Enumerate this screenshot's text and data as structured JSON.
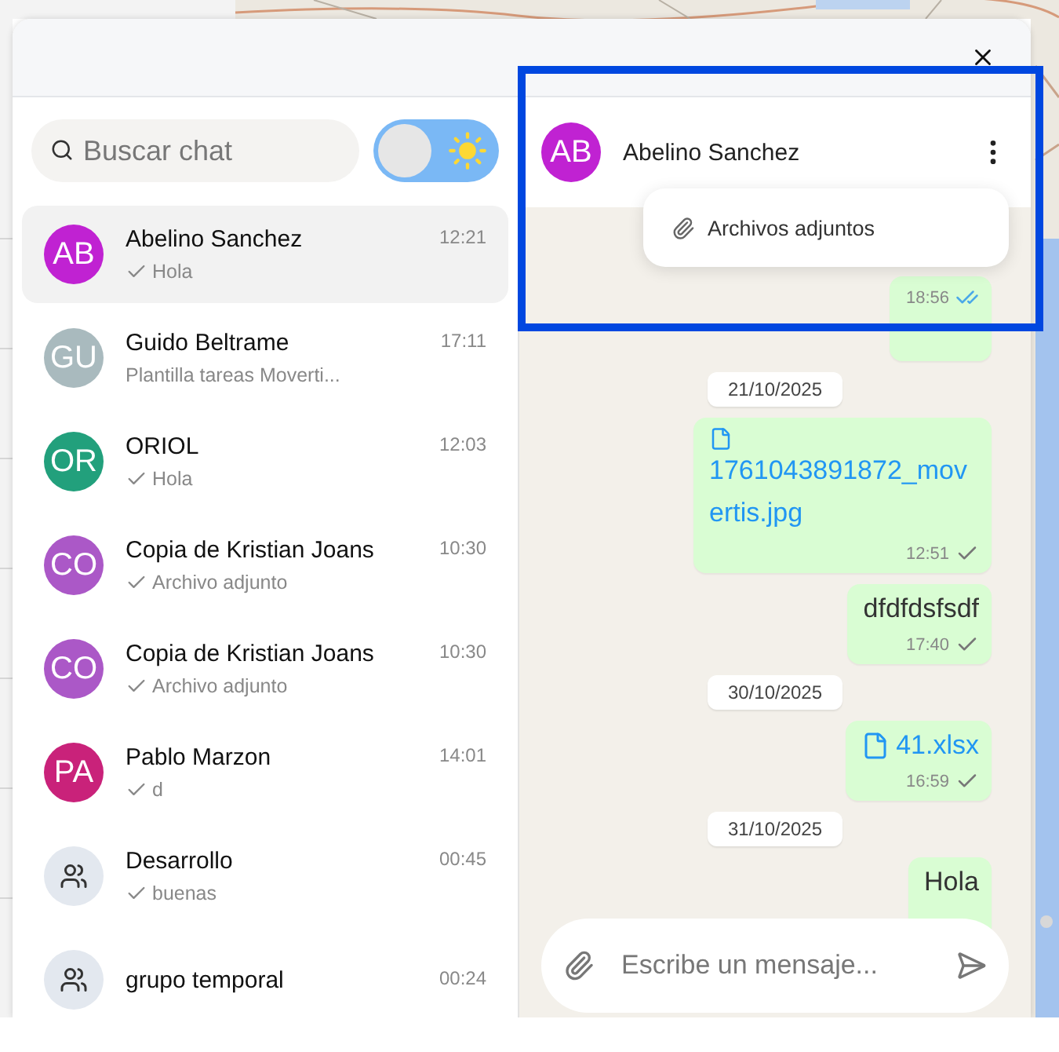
{
  "search": {
    "placeholder": "Buscar chat"
  },
  "theme_toggle": {
    "dark": false
  },
  "chats": [
    {
      "kind": "contact",
      "initials": "AB",
      "color": "#c022d2",
      "name": "Abelino Sanchez",
      "time": "12:21",
      "preview": "Hola",
      "ticked": true,
      "selected": true
    },
    {
      "kind": "contact",
      "initials": "GU",
      "color": "#a9babe",
      "name": "Guido Beltrame",
      "time": "17:11",
      "preview": "Plantilla tareas Moverti...",
      "ticked": false,
      "selected": false
    },
    {
      "kind": "contact",
      "initials": "OR",
      "color": "#22a07c",
      "name": "ORIOL",
      "time": "12:03",
      "preview": "Hola",
      "ticked": true,
      "selected": false
    },
    {
      "kind": "contact",
      "initials": "CO",
      "color": "#ab58c7",
      "name": "Copia de Kristian Joans",
      "time": "10:30",
      "preview": "Archivo adjunto",
      "ticked": true,
      "selected": false
    },
    {
      "kind": "contact",
      "initials": "CO",
      "color": "#ab58c7",
      "name": "Copia de Kristian Joans",
      "time": "10:30",
      "preview": "Archivo adjunto",
      "ticked": true,
      "selected": false
    },
    {
      "kind": "contact",
      "initials": "PA",
      "color": "#c9227a",
      "name": "Pablo Marzon",
      "time": "14:01",
      "preview": "d",
      "ticked": true,
      "selected": false
    },
    {
      "kind": "group",
      "name": "Desarrollo",
      "time": "00:45",
      "preview": "buenas",
      "ticked": true,
      "selected": false
    },
    {
      "kind": "group",
      "name": "grupo temporal",
      "time": "00:24",
      "selected": false
    }
  ],
  "conversation": {
    "initials": "AB",
    "color": "#c022d2",
    "name": "Abelino Sanchez",
    "menu": [
      {
        "label": "Archivos adjuntos"
      }
    ],
    "messages": [
      {
        "kind": "text",
        "time": "18:56",
        "read": true
      },
      {
        "kind": "date",
        "text": "21/10/2025"
      },
      {
        "kind": "file",
        "text": "1761043891872_movertis.jpg",
        "time": "12:51",
        "read": false
      },
      {
        "kind": "text",
        "text": "dfdfdsfsdf",
        "time": "17:40",
        "read": false
      },
      {
        "kind": "date",
        "text": "30/10/2025"
      },
      {
        "kind": "file_inline",
        "text": "41.xlsx",
        "time": "16:59",
        "read": false
      },
      {
        "kind": "date",
        "text": "31/10/2025"
      },
      {
        "kind": "text",
        "text": "Hola"
      }
    ]
  },
  "composer": {
    "placeholder": "Escribe un mensaje..."
  }
}
